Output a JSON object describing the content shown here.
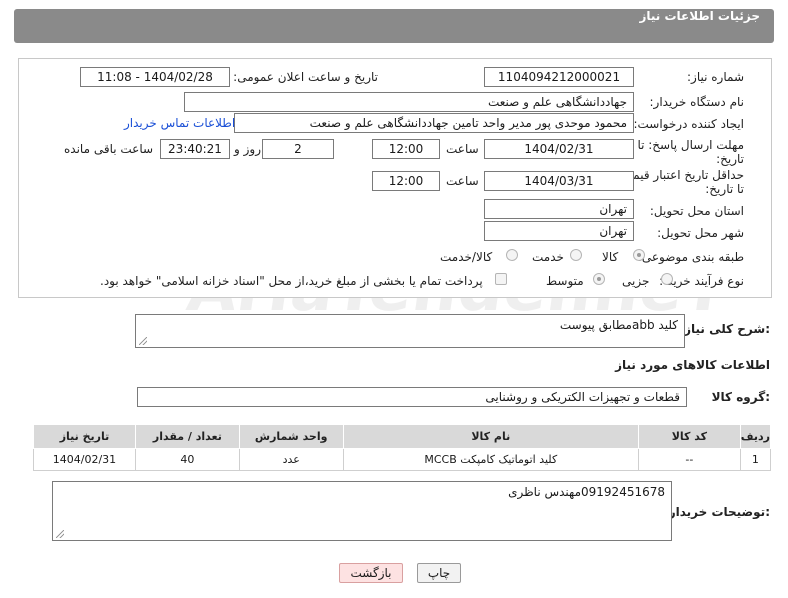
{
  "header": {
    "title": "جزئیات اطلاعات نیاز"
  },
  "need_number": {
    "label": "شماره نیاز:",
    "value": "1104094212000021"
  },
  "announce_datetime": {
    "label": "تاریخ و ساعت اعلان عمومی:",
    "value": "1404/02/28 - 11:08"
  },
  "buyer_org": {
    "label": "نام دستگاه خریدار:",
    "value": "جهاددانشگاهی علم و صنعت"
  },
  "requester": {
    "label": "ایجاد کننده درخواست:",
    "value": "محمود موحدی پور مدیر واحد تامین جهاددانشگاهی علم و صنعت",
    "contact_link": "اطلاعات تماس خریدار"
  },
  "reply_deadline": {
    "label_line1": "مهلت ارسال پاسخ: تا",
    "label_line2": "تاریخ:",
    "date": "1404/02/31",
    "time_label": "ساعت",
    "time": "12:00",
    "days": "2",
    "days_label": "روز و",
    "remaining": "23:40:21",
    "remaining_label": "ساعت باقی مانده"
  },
  "price_validity": {
    "label_line1": "حداقل تاریخ اعتبار قیمت:",
    "label_line2": "تا تاریخ:",
    "date": "1404/03/31",
    "time_label": "ساعت",
    "time": "12:00"
  },
  "delivery_province": {
    "label": "استان محل تحویل:",
    "value": "تهران"
  },
  "delivery_city": {
    "label": "شهر محل تحویل:",
    "value": "تهران"
  },
  "category": {
    "label": "طبقه بندی موضوعی:",
    "options": [
      "کالا",
      "خدمت",
      "کالا/خدمت"
    ],
    "selected": "کالا"
  },
  "purchase_process": {
    "label": "نوع فرآیند خرید :",
    "options": [
      "جزیی",
      "متوسط"
    ],
    "selected": "متوسط",
    "payment_note": "پرداخت تمام یا بخشی از مبلغ خرید،از محل \"اسناد خزانه اسلامی\" خواهد بود."
  },
  "description": {
    "label": "شرح کلی نیاز:",
    "value": "کلید abbمطابق پیوست"
  },
  "goods_info": {
    "title": "اطلاعات کالاهای مورد نیاز"
  },
  "goods_group": {
    "label": "گروه کالا:",
    "value": "قطعات و تجهیزات الکتریکی و روشنایی"
  },
  "items_table": {
    "headers": [
      "ردیف",
      "کد کالا",
      "نام کالا",
      "واحد شمارش",
      "تعداد / مقدار",
      "تاریخ نیاز"
    ],
    "rows": [
      [
        "1",
        "--",
        "کلید اتوماتیک کامپکت MCCB",
        "عدد",
        "40",
        "1404/02/31"
      ]
    ]
  },
  "buyer_notes": {
    "label": "توضیحات خریدار:",
    "value": "09192451678مهندس ناظری"
  },
  "buttons": {
    "print": "چاپ",
    "back": "بازگشت"
  },
  "watermark": "AriaTender.neT"
}
